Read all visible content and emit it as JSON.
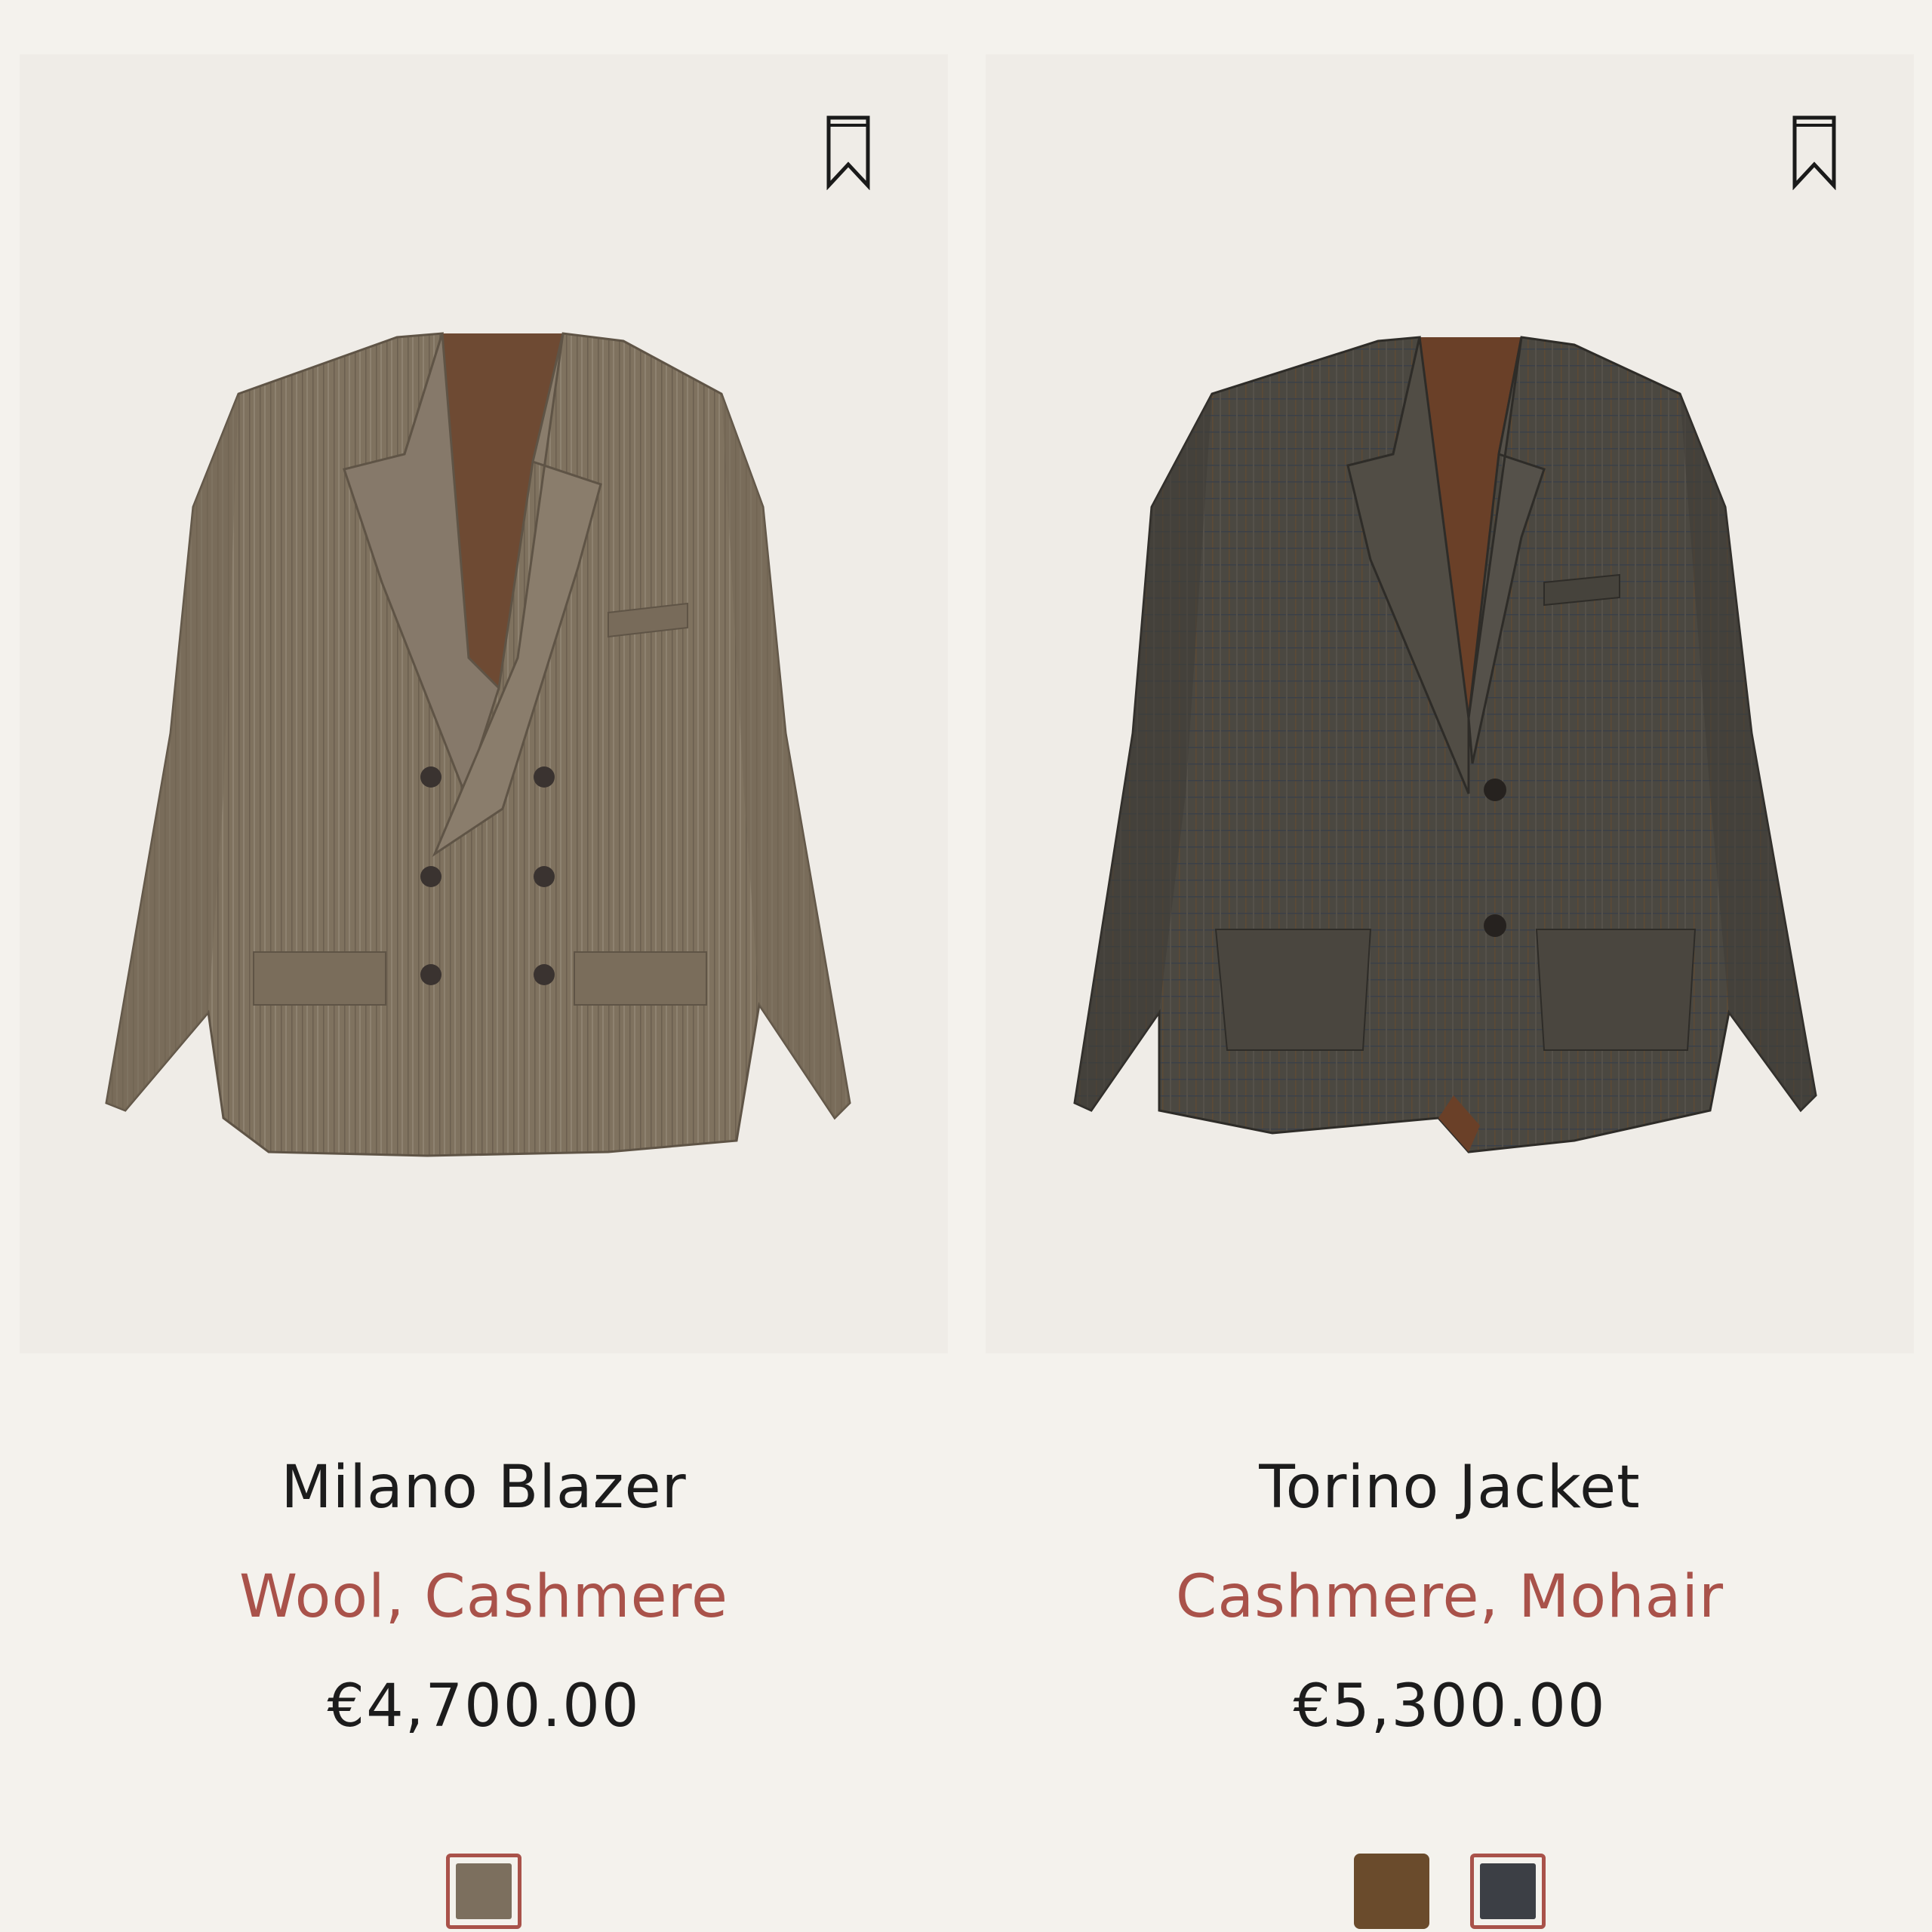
{
  "products": [
    {
      "name": "Milano Blazer",
      "materials": "Wool, Cashmere",
      "price": "€4,700.00",
      "swatches": [
        {
          "color": "#7c6f5e",
          "selected": true
        }
      ],
      "jacket_style": "double-breasted",
      "jacket_color": "#7f725f",
      "lining_color": "#6e4a33"
    },
    {
      "name": "Torino Jacket",
      "materials": "Cashmere, Mohair",
      "price": "€5,300.00",
      "swatches": [
        {
          "color": "#6a4b2c",
          "selected": false
        },
        {
          "color": "#3c3f45",
          "selected": true
        }
      ],
      "jacket_style": "single-breasted",
      "jacket_color": "#4b4841",
      "lining_color": "#6a4028"
    }
  ],
  "colors": {
    "accent": "#a9524a",
    "text": "#1c1c1c",
    "background": "#f4f2ed",
    "panel": "#efece7"
  },
  "icons": {
    "bookmark": "bookmark-icon"
  }
}
